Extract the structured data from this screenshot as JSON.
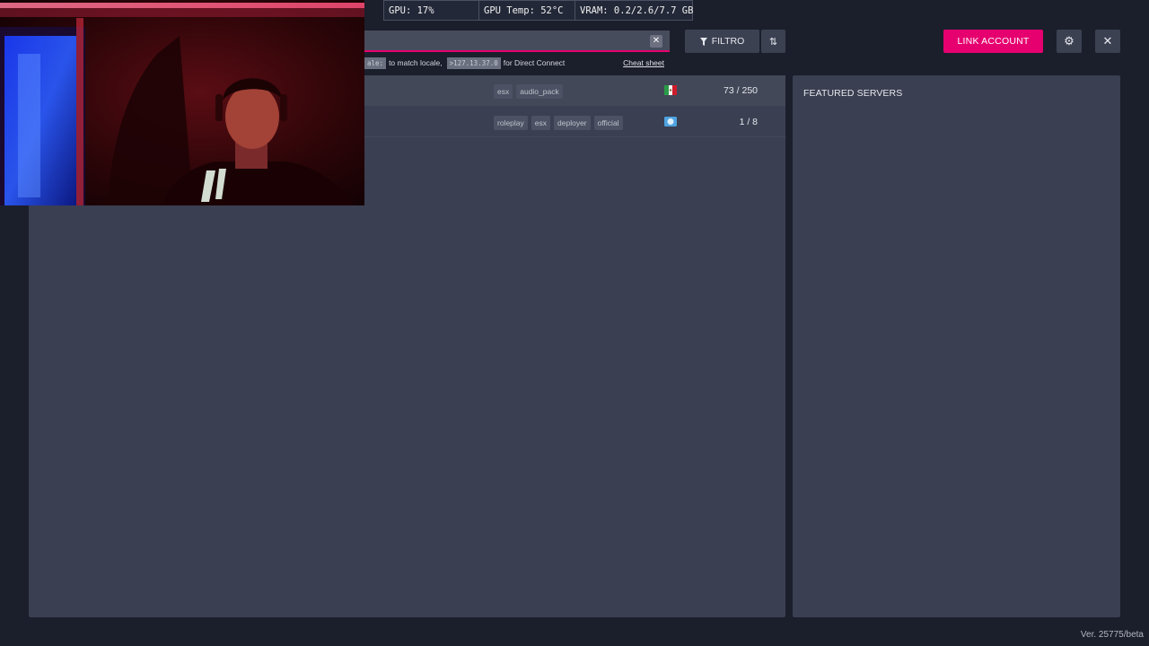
{
  "overlay": {
    "gpu": "GPU: 17%",
    "gpu_temp": "GPU Temp: 52°C",
    "vram": "VRAM: 0.2/2.6/7.7 GB"
  },
  "search": {
    "value": "",
    "clear_icon": "close-icon"
  },
  "hints": {
    "chip1": "ale:",
    "text1": "to match locale,",
    "chip2": ">127.13.37.0",
    "text2": "for Direct Connect",
    "cheat_sheet": "Cheat sheet"
  },
  "toolbar": {
    "filter_label": "FILTRO",
    "filter_icon": "funnel-icon",
    "sort_icon": "sort-arrows-icon",
    "link_account_label": "LINK ACCOUNT",
    "settings_icon": "gear-icon",
    "close_icon": "close-icon"
  },
  "servers": [
    {
      "tags": [
        "esx",
        "audio_pack"
      ],
      "flag": "mexico-flag",
      "players": "73 / 250"
    },
    {
      "tags": [
        "roleplay",
        "esx",
        "deployer",
        "official"
      ],
      "flag": "world-globe",
      "players": "1 / 8"
    }
  ],
  "featured": {
    "title": "FEATURED SERVERS"
  },
  "version": "Ver. 25775/beta",
  "colors": {
    "accent": "#e6006f",
    "background": "#1b1f2c",
    "panel": "#3a3f51"
  }
}
